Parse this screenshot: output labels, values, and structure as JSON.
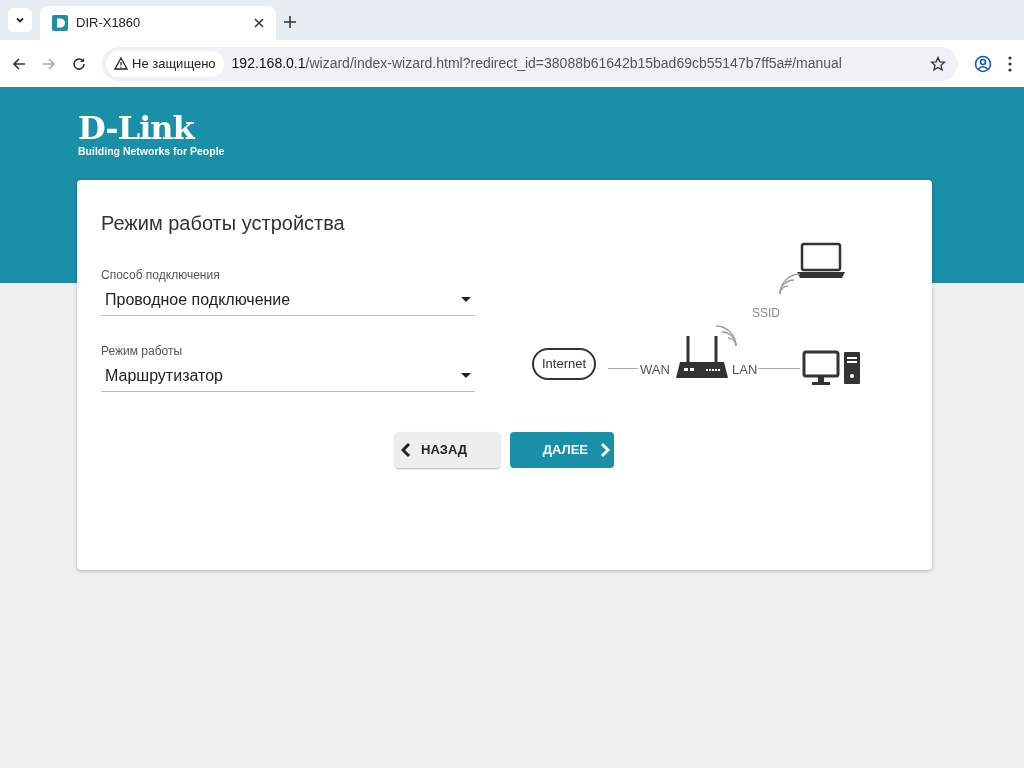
{
  "browser": {
    "tab_title": "DIR-X1860",
    "security_label": "Не защищено",
    "url_host": "192.168.0.1",
    "url_path": "/wizard/index-wizard.html?redirect_id=38088b61642b15bad69cb55147b7ff5a#/manual"
  },
  "logo": {
    "brand": "D-Link",
    "tagline": "Building Networks for People"
  },
  "card": {
    "title": "Режим работы устройства",
    "fields": [
      {
        "label": "Способ подключения",
        "value": "Проводное подключение"
      },
      {
        "label": "Режим работы",
        "value": "Маршрутизатор"
      }
    ],
    "diagram": {
      "internet": "Internet",
      "wan": "WAN",
      "lan": "LAN",
      "ssid": "SSID"
    },
    "buttons": [
      {
        "kind": "back",
        "label": "НАЗАД"
      },
      {
        "kind": "next",
        "label": "ДАЛЕЕ"
      }
    ]
  }
}
